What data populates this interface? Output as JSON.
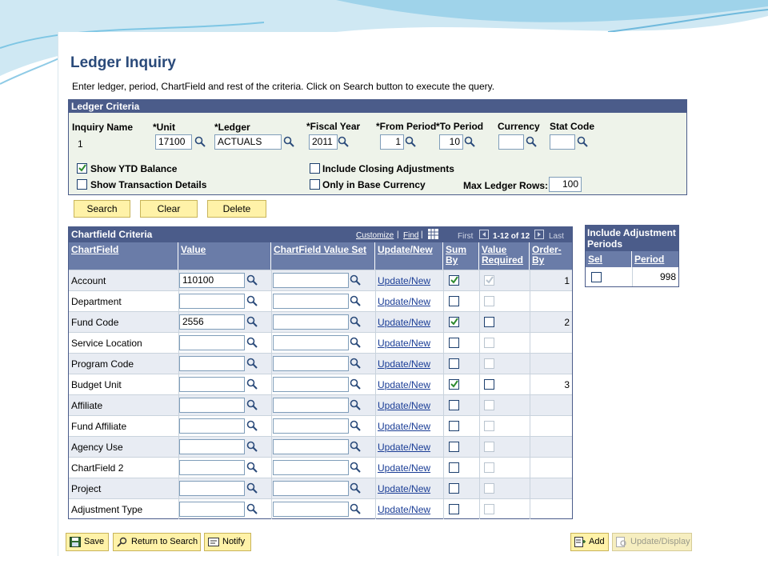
{
  "page": {
    "title": "Ledger Inquiry",
    "instructions": "Enter ledger, period, ChartField and rest of the criteria. Click on Search button to execute the query."
  },
  "ledger_criteria": {
    "header": "Ledger Criteria",
    "inquiry_name_label": "Inquiry Name",
    "inquiry_name_value": "1",
    "unit_label": "*Unit",
    "unit_value": "17100",
    "ledger_label": "*Ledger",
    "ledger_value": "ACTUALS",
    "fiscal_year_label": "*Fiscal Year",
    "fiscal_year_value": "2011",
    "from_period_label": "*From Period",
    "from_period_value": "1",
    "to_period_label": "*To Period",
    "to_period_value": "10",
    "currency_label": "Currency",
    "currency_value": "",
    "stat_code_label": "Stat Code",
    "stat_code_value": "",
    "show_ytd_label": "Show YTD Balance",
    "show_ytd_checked": true,
    "show_txn_label": "Show Transaction Details",
    "show_txn_checked": false,
    "include_closing_label": "Include Closing Adjustments",
    "include_closing_checked": false,
    "only_base_label": "Only in Base Currency",
    "only_base_checked": false,
    "max_rows_label": "Max Ledger Rows:",
    "max_rows_value": "100"
  },
  "actions": {
    "search": "Search",
    "clear": "Clear",
    "delete": "Delete"
  },
  "chartfield_grid": {
    "header": "Chartfield Criteria",
    "customize": "Customize",
    "find": "Find",
    "first": "First",
    "range": "1-12 of 12",
    "last": "Last",
    "columns": {
      "chartfield": "ChartField",
      "value": "Value",
      "value_set": "ChartField Value Set",
      "update": "Update/New",
      "sum_by": "Sum By",
      "value_required": "Value Required",
      "order_by": "Order-By"
    },
    "rows": [
      {
        "chartfield": "Account",
        "value": "110100",
        "value_set": "",
        "update": "Update/New",
        "sum_by": true,
        "value_required": true,
        "value_required_enabled": false,
        "order_by": "1"
      },
      {
        "chartfield": "Department",
        "value": "",
        "value_set": "",
        "update": "Update/New",
        "sum_by": false,
        "value_required": false,
        "value_required_enabled": false,
        "order_by": ""
      },
      {
        "chartfield": "Fund Code",
        "value": "2556",
        "value_set": "",
        "update": "Update/New",
        "sum_by": true,
        "value_required": false,
        "value_required_enabled": true,
        "order_by": "2"
      },
      {
        "chartfield": "Service Location",
        "value": "",
        "value_set": "",
        "update": "Update/New",
        "sum_by": false,
        "value_required": false,
        "value_required_enabled": false,
        "order_by": ""
      },
      {
        "chartfield": "Program Code",
        "value": "",
        "value_set": "",
        "update": "Update/New",
        "sum_by": false,
        "value_required": false,
        "value_required_enabled": false,
        "order_by": ""
      },
      {
        "chartfield": "Budget Unit",
        "value": "",
        "value_set": "",
        "update": "Update/New",
        "sum_by": true,
        "value_required": false,
        "value_required_enabled": true,
        "order_by": "3"
      },
      {
        "chartfield": "Affiliate",
        "value": "",
        "value_set": "",
        "update": "Update/New",
        "sum_by": false,
        "value_required": false,
        "value_required_enabled": false,
        "order_by": ""
      },
      {
        "chartfield": "Fund Affiliate",
        "value": "",
        "value_set": "",
        "update": "Update/New",
        "sum_by": false,
        "value_required": false,
        "value_required_enabled": false,
        "order_by": ""
      },
      {
        "chartfield": "Agency Use",
        "value": "",
        "value_set": "",
        "update": "Update/New",
        "sum_by": false,
        "value_required": false,
        "value_required_enabled": false,
        "order_by": ""
      },
      {
        "chartfield": "ChartField 2",
        "value": "",
        "value_set": "",
        "update": "Update/New",
        "sum_by": false,
        "value_required": false,
        "value_required_enabled": false,
        "order_by": ""
      },
      {
        "chartfield": "Project",
        "value": "",
        "value_set": "",
        "update": "Update/New",
        "sum_by": false,
        "value_required": false,
        "value_required_enabled": false,
        "order_by": ""
      },
      {
        "chartfield": "Adjustment Type",
        "value": "",
        "value_set": "",
        "update": "Update/New",
        "sum_by": false,
        "value_required": false,
        "value_required_enabled": false,
        "order_by": ""
      }
    ]
  },
  "adjustment_periods": {
    "header": "Include Adjustment Periods",
    "sel_label": "Sel",
    "period_label": "Period",
    "rows": [
      {
        "sel": false,
        "period": "998"
      }
    ]
  },
  "toolbar": {
    "save": "Save",
    "return_to_search": "Return to Search",
    "notify": "Notify",
    "add": "Add",
    "update_display": "Update/Display"
  },
  "colors": {
    "header_bg": "#4b5c8a",
    "button_bg": "#fff2a8",
    "link": "#1a3d96",
    "title": "#2a4a7a"
  }
}
